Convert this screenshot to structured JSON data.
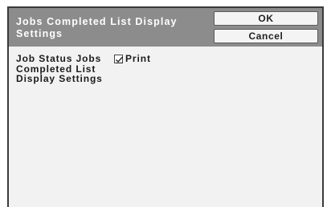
{
  "header": {
    "title": "Jobs Completed List Display Settings"
  },
  "buttons": {
    "ok_label": "OK",
    "cancel_label": "Cancel"
  },
  "setting": {
    "label": "Job Status Jobs Completed List Display Settings",
    "option_label": "Print",
    "option_checked": true
  },
  "icons": {
    "checkbox_mark": "check-icon"
  }
}
